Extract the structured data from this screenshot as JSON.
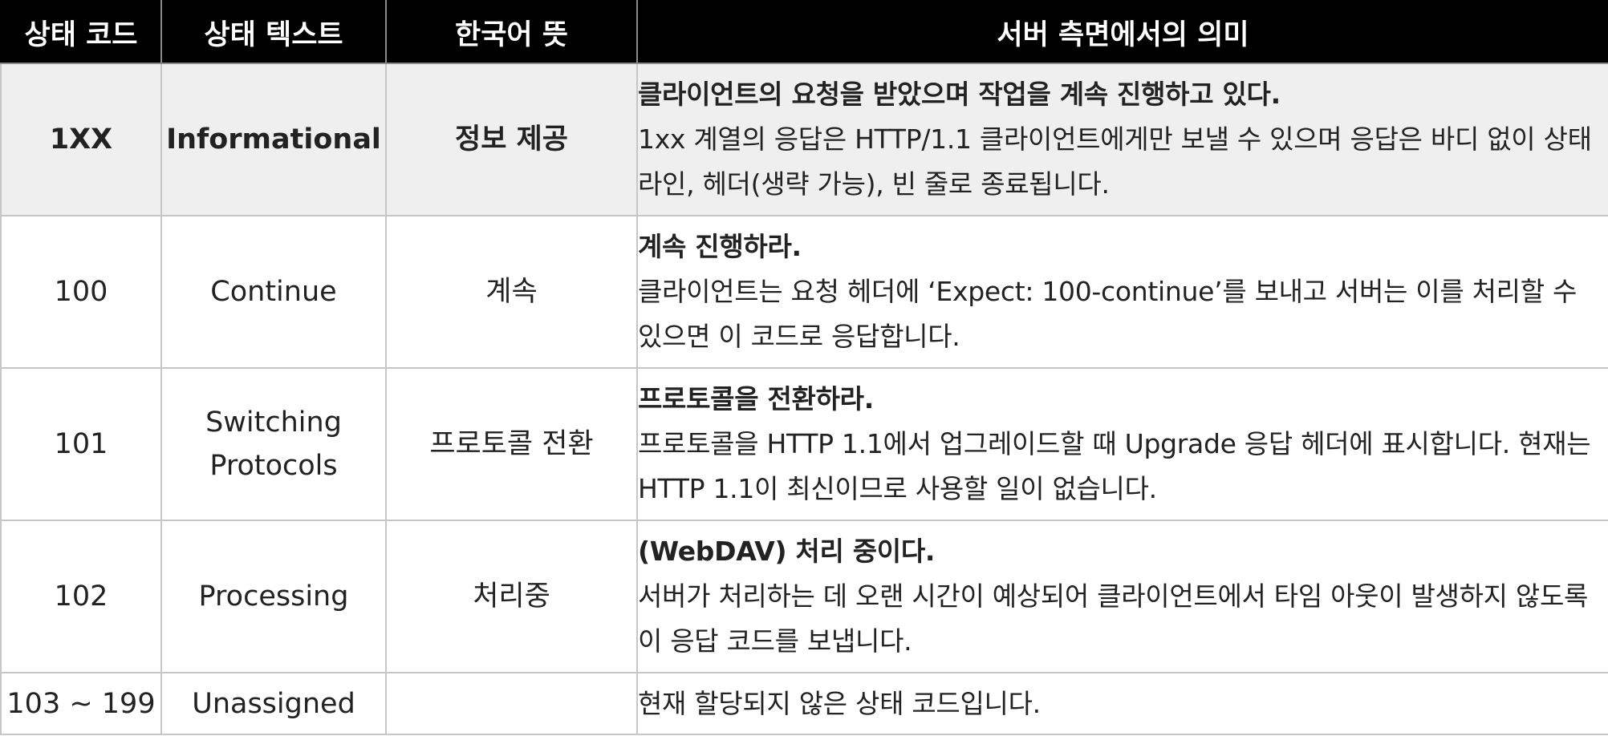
{
  "header": {
    "code": "상태 코드",
    "text": "상태 텍스트",
    "korean": "한국어 뜻",
    "meaning": "서버 측면에서의 의미"
  },
  "rows": [
    {
      "code": "1XX",
      "text": "Informational",
      "korean": "정보 제공",
      "title": "클라이언트의 요청을 받았으며 작업을 계속 진행하고 있다.",
      "desc": "1xx 계열의 응답은 HTTP/1.1 클라이언트에게만 보낼 수 있으며 응답은 바디 없이 상태 라인, 헤더(생략 가능), 빈 줄로 종료됩니다."
    },
    {
      "code": "100",
      "text": "Continue",
      "korean": "계속",
      "title": "계속 진행하라.",
      "desc": "클라이언트는 요청 헤더에 ‘Expect: 100-continue’를 보내고 서버는 이를 처리할 수 있으면 이 코드로 응답합니다."
    },
    {
      "code": "101",
      "text": "Switching Protocols",
      "korean": "프로토콜 전환",
      "title": "프로토콜을 전환하라.",
      "desc": "프로토콜을 HTTP 1.1에서 업그레이드할 때 Upgrade 응답 헤더에 표시합니다. 현재는 HTTP 1.1이 최신이므로 사용할 일이 없습니다."
    },
    {
      "code": "102",
      "text": "Processing",
      "korean": "처리중",
      "title": "(WebDAV) 처리 중이다.",
      "desc": "서버가 처리하는 데 오랜 시간이 예상되어 클라이언트에서 타임 아웃이 발생하지 않도록 이 응답 코드를 보냅니다."
    },
    {
      "code": "103 ~ 199",
      "text": "Unassigned",
      "korean": "",
      "title": "",
      "desc": "현재 할당되지 않은 상태 코드입니다."
    }
  ]
}
